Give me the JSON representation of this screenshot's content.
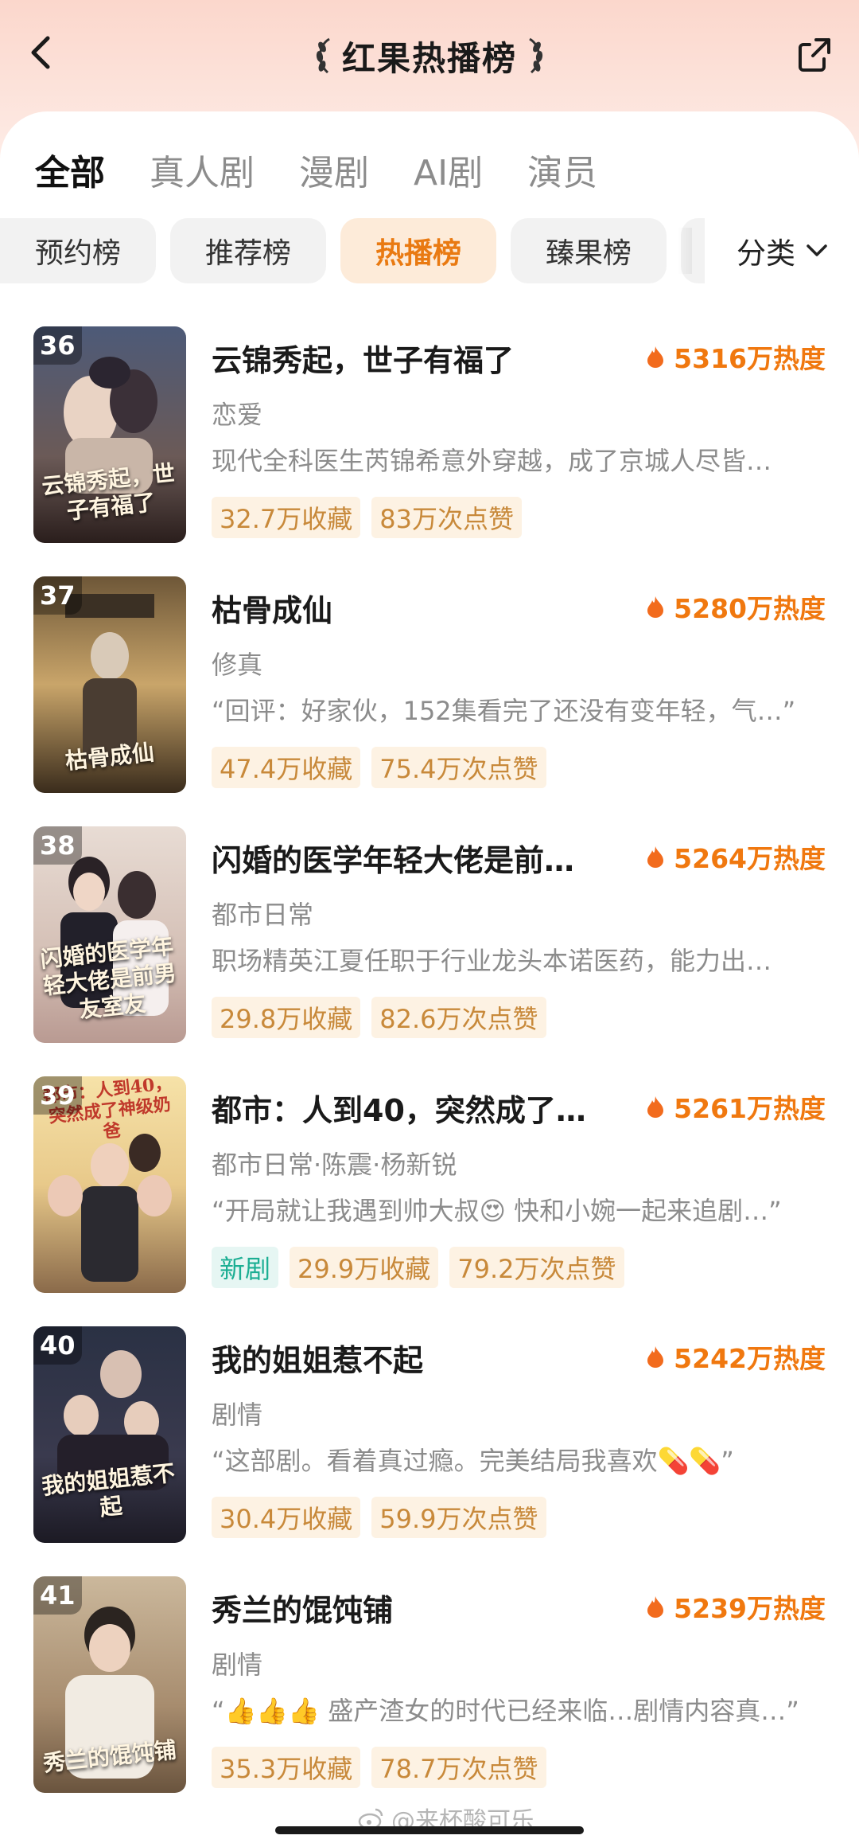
{
  "header": {
    "title": "红果热播榜",
    "back_icon": "chevron-left-icon",
    "share_icon": "share-icon"
  },
  "tabs": [
    {
      "label": "全部",
      "active": true
    },
    {
      "label": "真人剧",
      "active": false
    },
    {
      "label": "漫剧",
      "active": false
    },
    {
      "label": "AI剧",
      "active": false
    },
    {
      "label": "演员",
      "active": false
    }
  ],
  "chips": [
    {
      "label": "预约榜",
      "active": false
    },
    {
      "label": "推荐榜",
      "active": false
    },
    {
      "label": "热播榜",
      "active": true
    },
    {
      "label": "臻果榜",
      "active": false
    }
  ],
  "filter": {
    "label": "分类",
    "icon": "chevron-down-icon"
  },
  "colors": {
    "accent": "#f0780f",
    "tag_bg": "#fdf2e3",
    "tag_text": "#c8893a",
    "new_tag_text": "#1cae93"
  },
  "dramas": [
    {
      "rank": "36",
      "title": "云锦秀起，世子有福了",
      "heat": "5316万热度",
      "genre": "恋爱",
      "desc": "现代全科医生芮锦希意外穿越，成了京城人尽皆…",
      "tags": [
        "32.7万收藏",
        "83万次点赞"
      ],
      "new_tag": "",
      "poster_caption": "云锦秀起，世子有福了"
    },
    {
      "rank": "37",
      "title": "枯骨成仙",
      "heat": "5280万热度",
      "genre": "修真",
      "desc": "“回评：好家伙，152集看完了还没有变年轻，气…”",
      "tags": [
        "47.4万收藏",
        "75.4万次点赞"
      ],
      "new_tag": "",
      "poster_caption": "枯骨成仙"
    },
    {
      "rank": "38",
      "title": "闪婚的医学年轻大佬是前…",
      "heat": "5264万热度",
      "genre": "都市日常",
      "desc": "职场精英江夏任职于行业龙头本诺医药，能力出…",
      "tags": [
        "29.8万收藏",
        "82.6万次点赞"
      ],
      "new_tag": "",
      "poster_caption": "闪婚的医学年轻大佬是前男友室友"
    },
    {
      "rank": "39",
      "title": "都市：人到40，突然成了…",
      "heat": "5261万热度",
      "genre": "都市日常·陈震·杨新锐",
      "desc": "“开局就让我遇到帅大叔😍 快和小婉一起来追剧…”",
      "tags": [
        "29.9万收藏",
        "79.2万次点赞"
      ],
      "new_tag": "新剧",
      "poster_caption": "都市：人到40，突然成了神级奶爸"
    },
    {
      "rank": "40",
      "title": "我的姐姐惹不起",
      "heat": "5242万热度",
      "genre": "剧情",
      "desc": "“这部剧。看着真过瘾。完美结局我喜欢💊💊”",
      "tags": [
        "30.4万收藏",
        "59.9万次点赞"
      ],
      "new_tag": "",
      "poster_caption": "我的姐姐惹不起"
    },
    {
      "rank": "41",
      "title": "秀兰的馄饨铺",
      "heat": "5239万热度",
      "genre": "剧情",
      "desc": "“👍👍👍 盛产渣女的时代已经来临…剧情内容真…”",
      "tags": [
        "35.3万收藏",
        "78.7万次点赞"
      ],
      "new_tag": "",
      "poster_caption": "秀兰的馄饨铺"
    }
  ],
  "watermark": "@来杯酸可乐"
}
